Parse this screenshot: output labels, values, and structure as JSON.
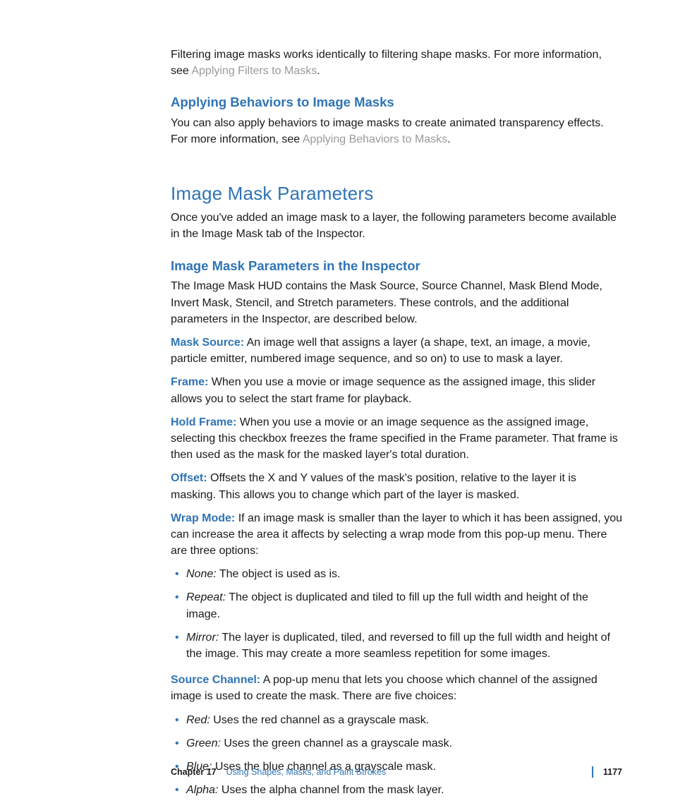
{
  "intro": {
    "p1a": "Filtering image masks works identically to filtering shape masks. For more information, see ",
    "link1": "Applying Filters to Masks",
    "p1b": "."
  },
  "sec1": {
    "heading": "Applying Behaviors to Image Masks",
    "p1a": "You can also apply behaviors to image masks to create animated transparency effects. For more information, see ",
    "link": "Applying Behaviors to Masks",
    "p1b": "."
  },
  "sec2": {
    "heading": "Image Mask Parameters",
    "p1": "Once you've added an image mask to a layer, the following parameters become available in the Image Mask tab of the Inspector."
  },
  "sec3": {
    "heading": "Image Mask Parameters in the Inspector",
    "p1": "The Image Mask HUD contains the Mask Source, Source Channel, Mask Blend Mode, Invert Mask, Stencil, and Stretch parameters. These controls, and the additional parameters in the Inspector, are described below."
  },
  "params": {
    "mask_source": {
      "label": "Mask Source:",
      "text": "  An image well that assigns a layer (a shape, text, an image, a movie, particle emitter, numbered image sequence, and so on) to use to mask a layer."
    },
    "frame": {
      "label": "Frame:",
      "text": "  When you use a movie or image sequence as the assigned image, this slider allows you to select the start frame for playback."
    },
    "hold_frame": {
      "label": "Hold Frame:",
      "text": "  When you use a movie or an image sequence as the assigned image, selecting this checkbox freezes the frame specified in the Frame parameter. That frame is then used as the mask for the masked layer's total duration."
    },
    "offset": {
      "label": "Offset:",
      "text": "  Offsets the X and Y values of the mask's position, relative to the layer it is masking. This allows you to change which part of the layer is masked."
    },
    "wrap_mode": {
      "label": "Wrap Mode:",
      "text": "  If an image mask is smaller than the layer to which it has been assigned, you can increase the area it affects by selecting a wrap mode from this pop-up menu. There are three options:"
    },
    "source_channel": {
      "label": "Source Channel:",
      "text": "  A pop-up menu that lets you choose which channel of the assigned image is used to create the mask. There are five choices:"
    }
  },
  "wrap_opts": {
    "none": {
      "name": "None:",
      "text": "  The object is used as is."
    },
    "repeat": {
      "name": "Repeat:",
      "text": "  The object is duplicated and tiled to fill up the full width and height of the image."
    },
    "mirror": {
      "name": "Mirror:",
      "text": "  The layer is duplicated, tiled, and reversed to fill up the full width and height of the image. This may create a more seamless repetition for some images."
    }
  },
  "channel_opts": {
    "red": {
      "name": "Red:",
      "text": "  Uses the red channel as a grayscale mask."
    },
    "green": {
      "name": "Green:",
      "text": "  Uses the green channel as a grayscale mask."
    },
    "blue": {
      "name": "Blue:",
      "text": "  Uses the blue channel as a grayscale mask."
    },
    "alpha": {
      "name": "Alpha:",
      "text": "  Uses the alpha channel from the mask layer."
    }
  },
  "footer": {
    "chapter": "Chapter 17",
    "title": "Using Shapes, Masks, and Paint Strokes",
    "page": "1177"
  }
}
